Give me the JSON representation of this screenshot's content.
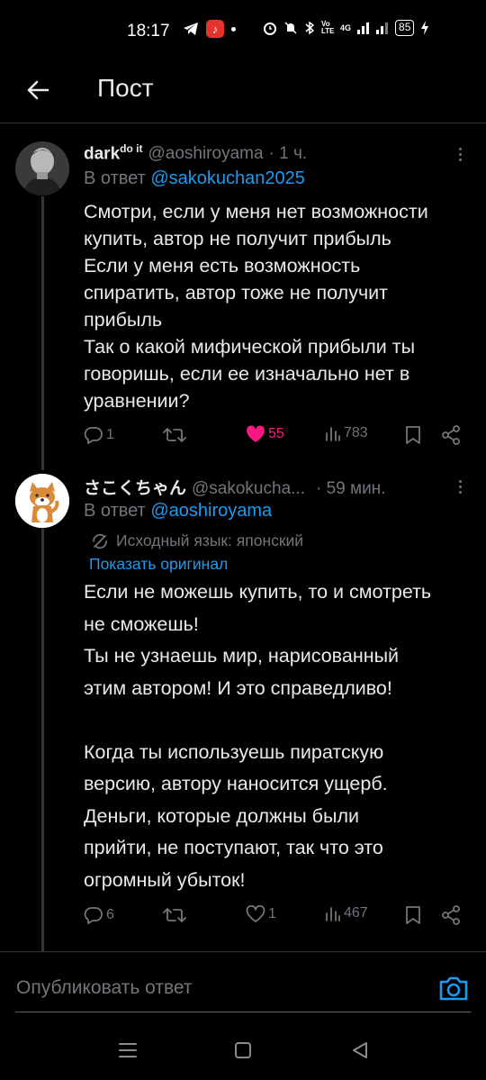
{
  "status_bar": {
    "time": "18:17",
    "app_badge": "♪",
    "network_a": "Vo LTE",
    "network_b": "4G",
    "battery": "85"
  },
  "header": {
    "title": "Пост"
  },
  "tweets": [
    {
      "name": "dark",
      "name_sup": "do it",
      "handle": "@aoshiroyama",
      "time": "· 1 ч.",
      "reply_prefix": "В ответ",
      "reply_handle": "@sakokuchan2025",
      "body": "Смотри, если у меня нет возможности\nкупить, автор не получит прибыль\nЕсли у меня есть возможность\nспиратить, автор тоже не получит\nприбыль\nТак о какой мифической прибыли ты\nговоришь, если ее изначально нет в\nуравнении?",
      "replies": "1",
      "retweets": "",
      "likes": "55",
      "views": "783",
      "liked": true
    },
    {
      "name": "さこくちゃん",
      "handle": "@sakokucha...",
      "time": "· 59 мин.",
      "reply_prefix": "В ответ",
      "reply_handle": "@aoshiroyama",
      "translated_from": "Исходный язык: японский",
      "show_original": "Показать оригинал",
      "body": "Если не можешь купить, то и смотреть\nне сможешь!\nТы не узнаешь мир, нарисованный\nэтим автором! И это справедливо!\n\nКогда ты используешь пиратскую\nверсию, автору наносится ущерб.\nДеньги, которые должны были\nприйти, не поступают, так что это\nогромный убыток!",
      "replies": "6",
      "retweets": "",
      "likes": "1",
      "views": "467",
      "liked": false
    }
  ],
  "compose": {
    "placeholder": "Опубликовать ответ"
  },
  "colors": {
    "background": "#000000",
    "text": "#e7e9ea",
    "secondary": "#71767b",
    "link": "#1d9bf0",
    "like": "#f91880"
  }
}
